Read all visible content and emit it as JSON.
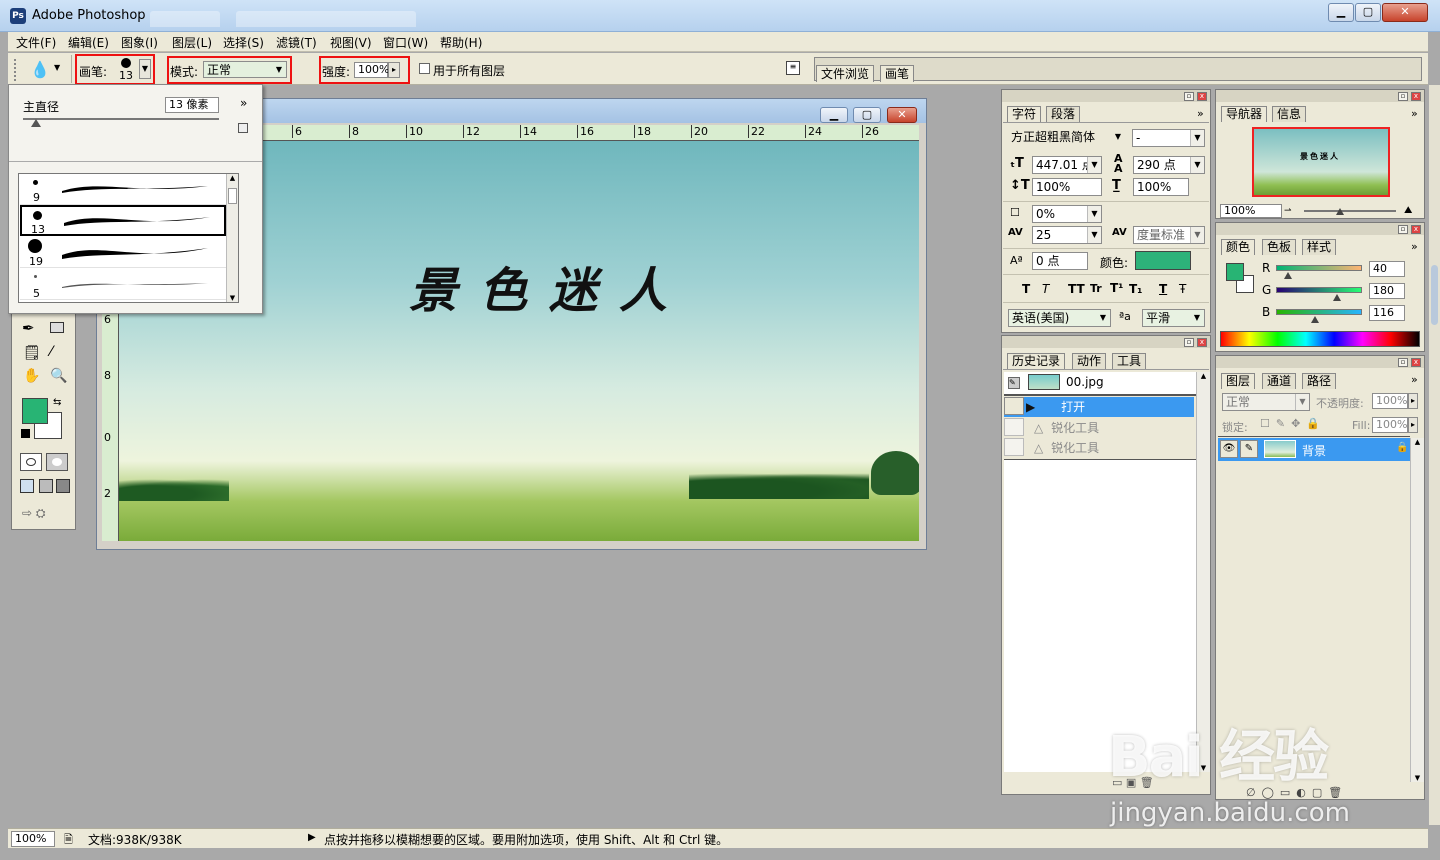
{
  "window": {
    "title": "Adobe Photoshop",
    "min_glyph": "▁",
    "max_glyph": "▢",
    "close_glyph": "✕"
  },
  "menu": [
    "文件(F)",
    "编辑(E)",
    "图象(I)",
    "图层(L)",
    "选择(S)",
    "滤镜(T)",
    "视图(V)",
    "窗口(W)",
    "帮助(H)"
  ],
  "options": {
    "brush_label": "画笔:",
    "brush_size": "13",
    "mode_label": "模式:",
    "mode_value": "正常",
    "strength_label": "强度:",
    "strength_value": "100%",
    "all_layers_label": "用于所有图层",
    "well_tabs": [
      "文件浏览",
      "画笔"
    ]
  },
  "brush_popup": {
    "master_diameter_label": "主直径",
    "master_diameter_value": "13 像素",
    "more_glyph": "»",
    "brushes": [
      "9",
      "13",
      "19",
      "5"
    ]
  },
  "document": {
    "canvas_text": "景色迷人",
    "ruler_top": [
      "6",
      "8",
      "10",
      "12",
      "14",
      "16",
      "18",
      "20",
      "22",
      "24",
      "26"
    ],
    "ruler_left": [
      "6",
      "8",
      "0",
      "2"
    ],
    "canvas_color_colors": {
      "accent": "#2db27a"
    }
  },
  "toolbox": {
    "foreground_color": "#28b474",
    "background_color": "#ffffff"
  },
  "char_panel": {
    "tabs": [
      "字符",
      "段落"
    ],
    "font_family": "方正超粗黑简体",
    "font_style": "-",
    "font_size": "447.01 点",
    "leading": "290 点",
    "vertical_scale": "100%",
    "horizontal_scale": "100%",
    "tracking_pct": "0%",
    "kerning_value": "25",
    "kerning_mode": "度量标准",
    "baseline": "0 点",
    "color_label": "颜色:",
    "color": "#2db27a",
    "style_buttons": [
      "T",
      "T",
      "TT",
      "Tr",
      "T¹",
      "T₁",
      "T",
      "Ŧ"
    ],
    "language": "英语(美国)",
    "aa_label": "ªa",
    "antialias": "平滑"
  },
  "history_panel": {
    "tabs": [
      "历史记录",
      "动作",
      "工具"
    ],
    "snapshot": "00.jpg",
    "items": [
      "打开",
      "锐化工具",
      "锐化工具"
    ]
  },
  "navigator_panel": {
    "tabs": [
      "导航器",
      "信息"
    ],
    "zoom": "100%",
    "preview_text": "景色迷人"
  },
  "color_panel": {
    "tabs": [
      "颜色",
      "色板",
      "样式"
    ],
    "r_label": "R",
    "g_label": "G",
    "b_label": "B",
    "r": "40",
    "g": "180",
    "b": "116",
    "swatch": "#28b474"
  },
  "layers_panel": {
    "tabs": [
      "图层",
      "通道",
      "路径"
    ],
    "blend_mode": "正常",
    "opacity_label": "不透明度:",
    "opacity_value": "100%",
    "lock_label": "锁定:",
    "fill_label": "Fill:",
    "fill_value": "100%",
    "layer_name": "背景"
  },
  "status": {
    "zoom": "100%",
    "doc_info": "文档:938K/938K",
    "hint": "点按并拖移以模糊想要的区域。要用附加选项，使用 Shift、Alt 和 Ctrl 键。"
  },
  "watermark": {
    "logo": "Bai  经验",
    "url": "jingyan.baidu.com"
  }
}
